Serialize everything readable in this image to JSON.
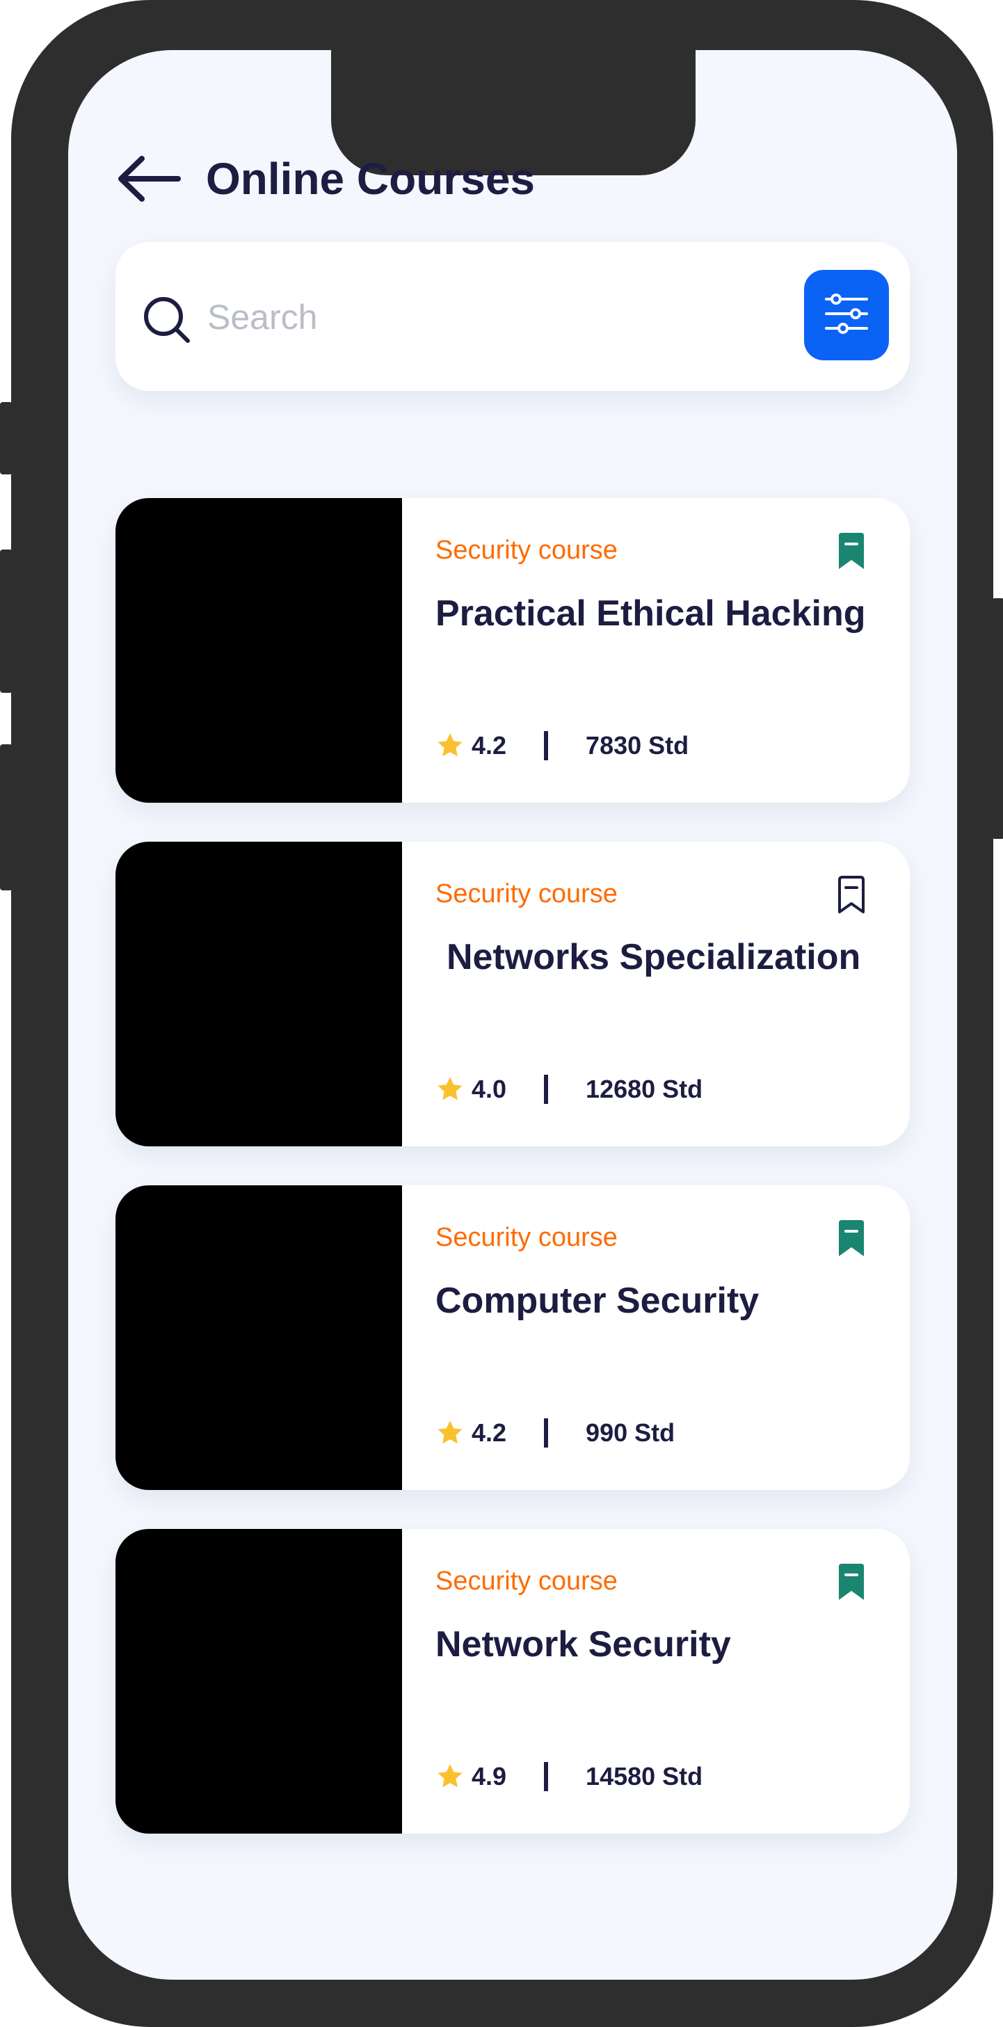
{
  "colors": {
    "accent": "#0b63f6",
    "category": "#ff6b00",
    "bookmark_saved": "#1a8571",
    "title_text": "#1d1d42",
    "star": "#f9c12e",
    "screen_bg": "#f4f7fd"
  },
  "header": {
    "back_icon": "arrow-left-icon",
    "title": "Online Courses"
  },
  "search": {
    "icon": "search-icon",
    "placeholder": "Search",
    "value": "",
    "filter_icon": "sliders-icon"
  },
  "courses": [
    {
      "category": "Security course",
      "title": "Practical Ethical Hacking",
      "rating": "4.2",
      "students": "7830 Std",
      "bookmarked": true
    },
    {
      "category": "Security course",
      "title": "Networks Specialization",
      "rating": "4.0",
      "students": "12680 Std",
      "bookmarked": false
    },
    {
      "category": "Security course",
      "title": "Computer Security",
      "rating": "4.2",
      "students": "990 Std",
      "bookmarked": true
    },
    {
      "category": "Security course",
      "title": "Network Security",
      "rating": "4.9",
      "students": "14580 Std",
      "bookmarked": true
    }
  ]
}
